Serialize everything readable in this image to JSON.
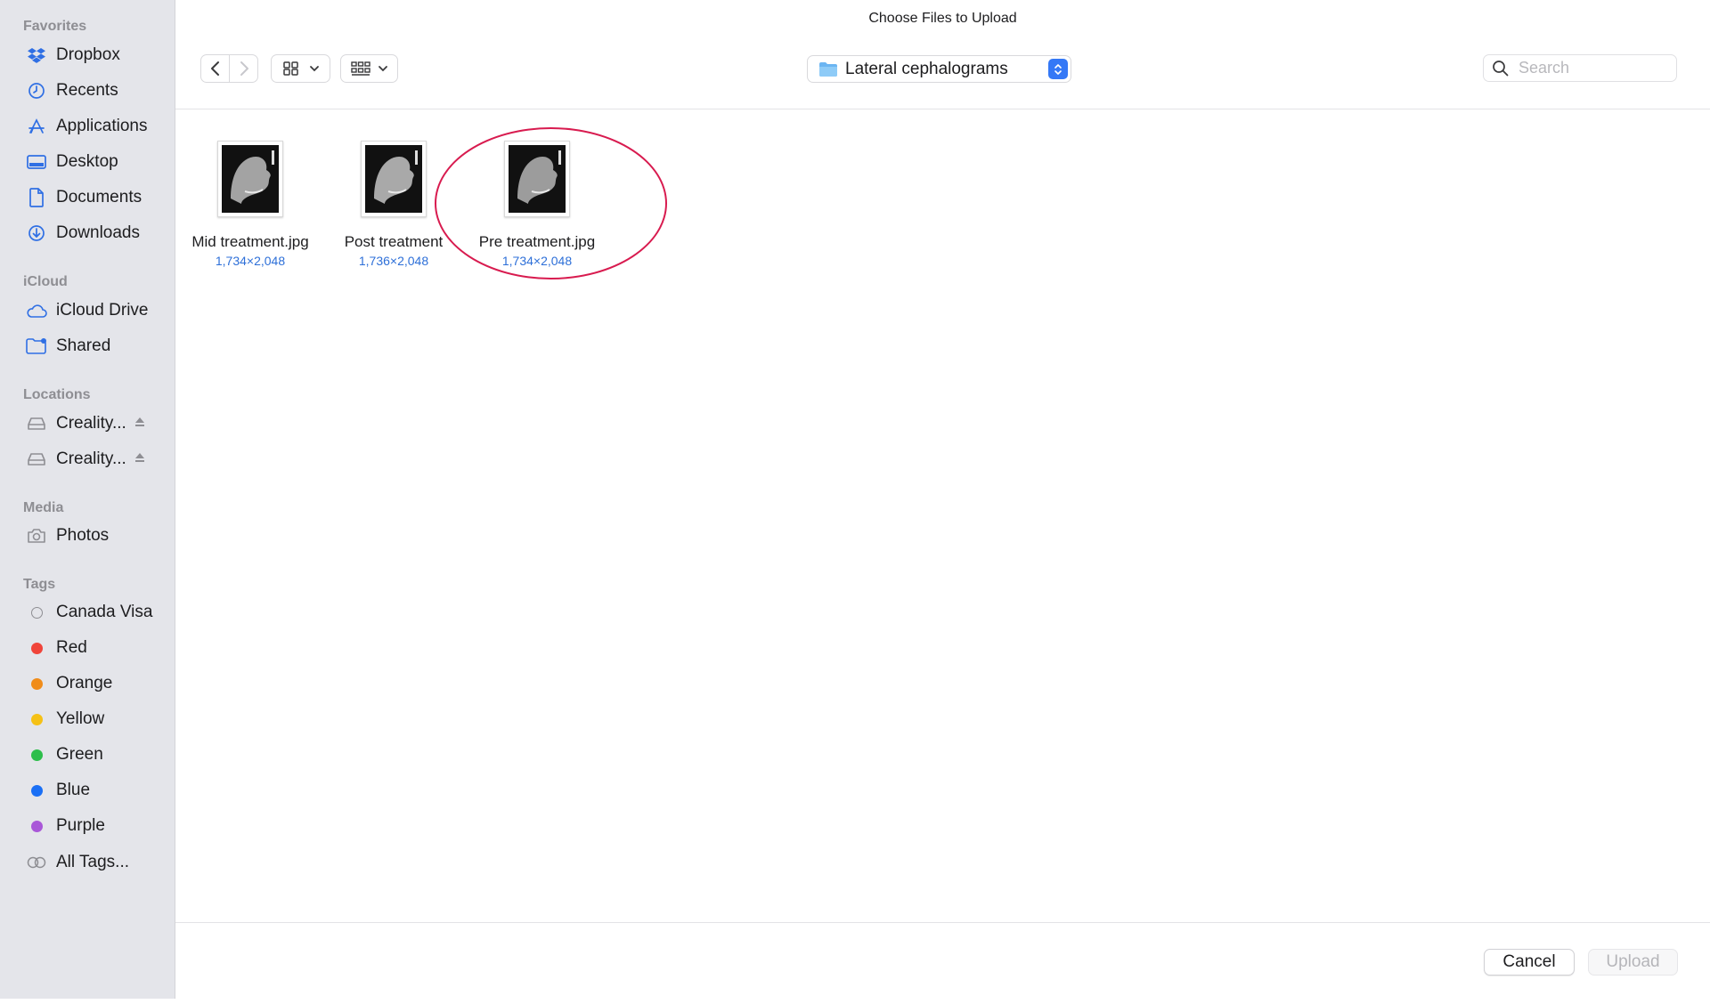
{
  "dialog": {
    "title": "Choose Files to Upload"
  },
  "sidebar": {
    "sections": {
      "favorites": "Favorites",
      "icloud": "iCloud",
      "locations": "Locations",
      "media": "Media",
      "tags": "Tags"
    },
    "favorites": [
      {
        "label": "Dropbox",
        "icon": "dropbox-icon"
      },
      {
        "label": "Recents",
        "icon": "clock-icon"
      },
      {
        "label": "Applications",
        "icon": "applications-icon"
      },
      {
        "label": "Desktop",
        "icon": "desktop-icon"
      },
      {
        "label": "Documents",
        "icon": "document-icon"
      },
      {
        "label": "Downloads",
        "icon": "download-icon"
      }
    ],
    "icloud": [
      {
        "label": "iCloud Drive",
        "icon": "cloud-icon"
      },
      {
        "label": "Shared",
        "icon": "shared-folder-icon"
      }
    ],
    "locations": [
      {
        "label": "Creality...",
        "icon": "drive-icon"
      },
      {
        "label": "Creality...",
        "icon": "drive-icon"
      }
    ],
    "media": [
      {
        "label": "Photos",
        "icon": "camera-icon"
      }
    ],
    "tags": [
      {
        "label": "Canada Visa",
        "color": ""
      },
      {
        "label": "Red",
        "color": "#f0443a"
      },
      {
        "label": "Orange",
        "color": "#f08c1a"
      },
      {
        "label": "Yellow",
        "color": "#f5c116"
      },
      {
        "label": "Green",
        "color": "#2dbe4b"
      },
      {
        "label": "Blue",
        "color": "#1a6ff5"
      },
      {
        "label": "Purple",
        "color": "#a957d8"
      },
      {
        "label": "All Tags...",
        "color": ""
      }
    ]
  },
  "toolbar": {
    "location": "Lateral cephalograms",
    "search_placeholder": "Search"
  },
  "files": [
    {
      "name": "Mid treatment.jpg",
      "dims": "1,734×2,048"
    },
    {
      "name": "Post treatment",
      "dims": "1,736×2,048"
    },
    {
      "name": "Pre treatment.jpg",
      "dims": "1,734×2,048"
    }
  ],
  "footer": {
    "cancel_label": "Cancel",
    "upload_label": "Upload"
  },
  "colors": {
    "accent": "#3478f6",
    "highlight_circle": "#d81b4f",
    "link_blue": "#2d6fd8"
  }
}
